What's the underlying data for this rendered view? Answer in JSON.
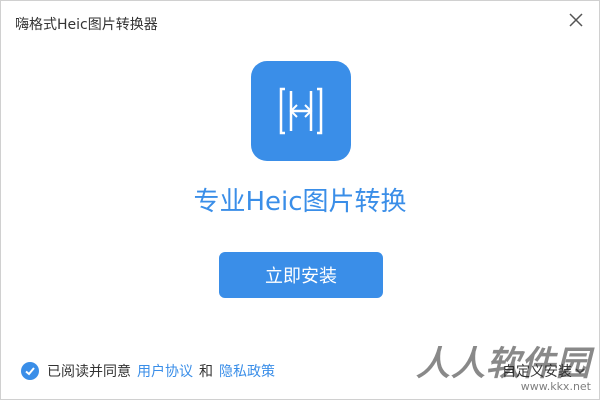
{
  "window": {
    "title": "嗨格式Heic图片转换器"
  },
  "icons": {
    "close": "close-icon",
    "logo": "h-logo-icon",
    "check": "check-icon",
    "chevron": "chevron-down-icon"
  },
  "main": {
    "headline": "专业Heic图片转换",
    "install_label": "立即安装"
  },
  "footer": {
    "agree_text": "已阅读并同意",
    "user_agreement": "用户协议",
    "and_text": "和",
    "privacy_policy": "隐私政策",
    "custom_install": "自定义安装"
  },
  "watermark": {
    "main": "人人软件园",
    "url": "www.kkx.net"
  },
  "colors": {
    "accent": "#3a8ee8",
    "text": "#333333",
    "background": "#ffffff"
  }
}
